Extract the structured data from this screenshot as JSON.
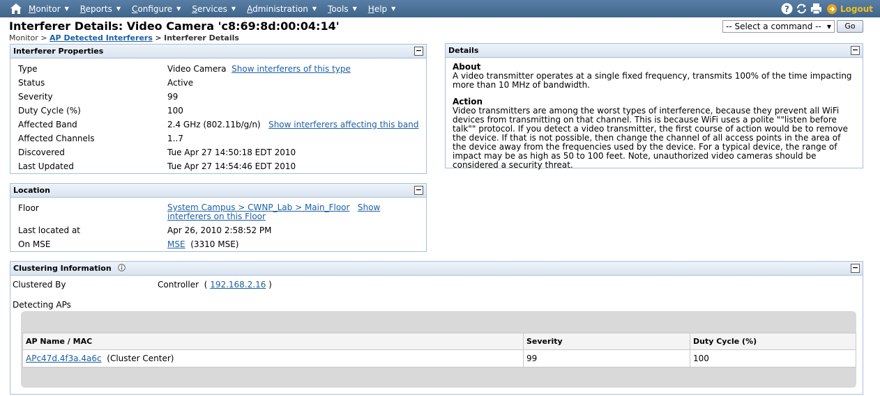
{
  "nav": {
    "menu": [
      "Monitor",
      "Reports",
      "Configure",
      "Services",
      "Administration",
      "Tools",
      "Help"
    ],
    "logout": "Logout"
  },
  "page": {
    "title": "Interferer Details:  Video Camera 'c8:69:8d:00:04:14'",
    "breadcrumb": {
      "root": "Monitor",
      "sep1": ">",
      "link": "AP Detected Interferers",
      "sep2": ">",
      "current": "Interferer Details"
    }
  },
  "command": {
    "selected": "-- Select a command --",
    "go": "Go"
  },
  "properties": {
    "title": "Interferer Properties",
    "rows": [
      {
        "label": "Type",
        "value": "Video Camera",
        "link": "Show interferers of this type"
      },
      {
        "label": "Status",
        "value": "Active"
      },
      {
        "label": "Severity",
        "value": "99"
      },
      {
        "label": "Duty Cycle (%)",
        "value": "100"
      },
      {
        "label": "Affected Band",
        "value": "2.4 GHz (802.11b/g/n)",
        "link": "Show interferers affecting this band"
      },
      {
        "label": "Affected Channels",
        "value": "1..7"
      },
      {
        "label": "Discovered",
        "value": "Tue Apr 27 14:50:18 EDT 2010"
      },
      {
        "label": "Last Updated",
        "value": "Tue Apr 27 14:54:46 EDT 2010"
      }
    ]
  },
  "location": {
    "title": "Location",
    "floor_label": "Floor",
    "floor_link": "System Campus > CWNP_Lab > Main_Floor",
    "floor_show": "Show",
    "floor_show2": "interferers on this Floor",
    "last_located_label": "Last located at",
    "last_located_value": "Apr 26, 2010 2:58:52 PM",
    "mse_label": "On MSE",
    "mse_link": "MSE",
    "mse_value": "(3310 MSE)"
  },
  "details": {
    "title": "Details",
    "about_heading": "About",
    "about_text": "A video transmitter operates at a single fixed frequency, transmits 100% of the time impacting more than 10 MHz of bandwidth.",
    "action_heading": "Action",
    "action_text": "Video transmitters are among the worst types of interference, because they prevent all WiFi devices from transmitting on that channel. This is because WiFi uses a polite \"\"listen before talk\"\" protocol. If you detect a video transmitter, the first course of action would be to remove the device. If that is not possible, then change the channel of all access points in the area of the device away from the frequencies used by the device. For a typical device, the range of impact may be as high as 50 to 100 feet. Note, unauthorized video cameras should be considered a security threat."
  },
  "clustering": {
    "title": "Clustering Information",
    "clustered_by_label": "Clustered By",
    "clustered_by_value": "Controller",
    "paren_open": "(",
    "controller_ip": "192.168.2.16",
    "paren_close": ")",
    "detecting_label": "Detecting APs",
    "columns": [
      "AP Name / MAC",
      "Severity",
      "Duty Cycle (%)"
    ],
    "rows": [
      {
        "ap": "APc47d.4f3a.4a6c",
        "note": "(Cluster Center)",
        "severity": "99",
        "duty": "100"
      }
    ]
  }
}
